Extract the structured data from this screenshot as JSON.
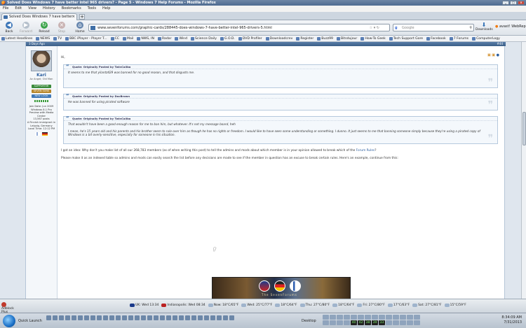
{
  "window": {
    "title": "Solved Does Windows 7 have better intel 965 drivers? - Page 5 - Windows 7 Help Forums - Mozilla Firefox"
  },
  "menu": [
    "File",
    "Edit",
    "View",
    "History",
    "Bookmarks",
    "Tools",
    "Help"
  ],
  "tab": {
    "label": "Solved Does Windows 7 have better intel 965 ...",
    "new_tab": "+"
  },
  "nav": {
    "back": "Back",
    "forward": "Forward",
    "reload": "Reload",
    "stop": "Stop",
    "home": "Home",
    "url": "www.sevenforums.com/graphic-cards/288445-does-windows-7-have-better-intel-965-drivers-5.html",
    "search_placeholder": "Google",
    "downloads": "Downloads",
    "avast": "avast! WebRep"
  },
  "bookmarks": [
    "Latest Headlines",
    "NEWS",
    "TV",
    "BBC iPlayer - Player T...",
    "CC",
    "Mail",
    "NWS, IN",
    "Radar",
    "Wind",
    "Science Daily",
    "G.O.D.",
    "DVD Profiler",
    "Downloadcrev",
    "Register",
    "Buzz99",
    "Bitsdujour",
    "How-To Geek",
    "Tech Support Gore",
    "Facebook",
    "7 Forums",
    "ComputerLogy"
  ],
  "post": {
    "header": "3 Days Ago",
    "number": "#44",
    "user": {
      "name": "Kari",
      "title": "Av Angel; Old Man",
      "stats": "Join Date: Jun 2009\nWindows 8.1 Pro Preview with Media Center\n13,567 posts\nA Finnish immigrant in Leipzig, Germany\nLocal Time: 12:12 PM",
      "badges": [
        "SUPPORTER",
        "SEVEN SUNS",
        "NEW LOOK"
      ]
    },
    "greeting": "Hi,",
    "quotes": [
      {
        "head": "Quote: Originally Posted by TwinCaliba",
        "body": "It seems to me that yilantz429 was banned for no good reason, and that disgusts me."
      },
      {
        "head": "Quote: Originally Posted by DocBrown",
        "body": "He was banned for using pirated software"
      },
      {
        "head": "Quote: Originally Posted by TwinCaliba",
        "body": "That wouldn't have been a good enough reason for me to ban him, but whatever. It's not my message board, heh\n\nI mean, he's 15 years old and his parents and his brother seem to rule over him as though he has no rights or freedom. I would like to have seen some understanding or something. I dunno. It just seems to me that banning someone simply because they're using a pirated copy of Windows is a bit overly-sensitive, especially for someone in his situation."
      }
    ],
    "reply1_a": "I got an idea: Why don't you make list of all our 268,783 members (as of when writing this post) to tell the admins and mods about which member is in your opinion allowed to break which of the ",
    "reply1_link": "Forum Rules",
    "reply1_b": "?",
    "reply2": "Please make it as an indexed table so admins and mods can easily search the list before any decisions are made to see if the member in question has an excuse to break certain rules. Here's an example, continue from this:",
    "signature": "The SevenForums"
  },
  "status": {
    "adblock": "Adblock Plus",
    "items": [
      "UK: Wed 13:34",
      "Indianapolis: Wed 08:34",
      "Now: 18°C/65°F",
      "Wed: 25°C/77°F",
      "18°C/64°F",
      "Thu: 27°C/80°F",
      "18°C/64°F",
      "Fri: 27°C/80°F",
      "17°C/63°F",
      "Sat: 27°C/81°F",
      "15°C/59°F"
    ]
  },
  "taskbar": {
    "quick_launch": "Quick Launch",
    "desktop": "Desktop",
    "tray_numbers": [
      "40",
      "42",
      "38",
      "39",
      "33"
    ],
    "time": "8:34:09 AM",
    "date": "7/31/2013"
  }
}
